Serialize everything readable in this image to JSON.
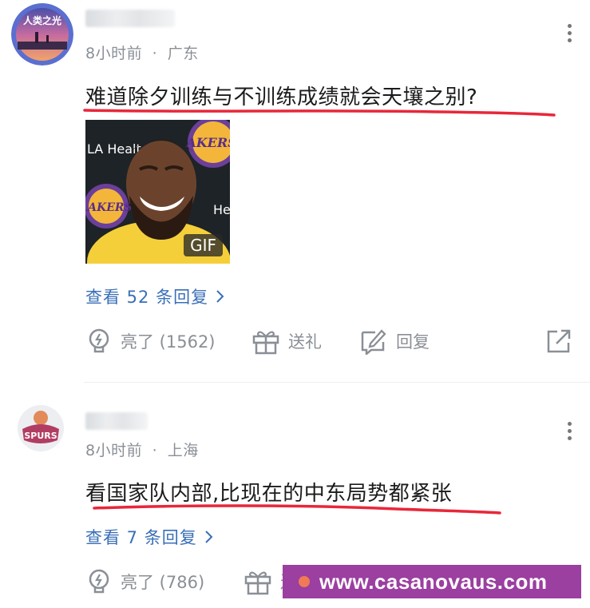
{
  "comments": [
    {
      "time": "8小时前",
      "location": "广东",
      "text": "难道除夕训练与不训练成绩就会天壤之别?",
      "attachment": {
        "badge": "GIF",
        "sign_texts": [
          "LA Healt",
          "LAKERS",
          "He",
          "AKERS"
        ]
      },
      "replies": "查看 52 条回复",
      "like_label": "亮了 (1562)",
      "gift_label": "送礼",
      "reply_label": "回复",
      "avatar_text": "人类之光"
    },
    {
      "time": "8小时前",
      "location": "上海",
      "text": "看国家队内部,比现在的中东局势都紧张",
      "replies": "查看 7 条回复",
      "like_label": "亮了 (786)",
      "gift_label": "送",
      "avatar_text": "SPURS"
    }
  ],
  "separator": "·",
  "watermark": "www.casanovaus.com",
  "icons": [
    "more-icon",
    "lightbulb-icon",
    "gift-icon",
    "edit-icon",
    "share-icon",
    "chevron-right-icon"
  ],
  "colors": {
    "underline": "#e8273a",
    "link": "#3a6fb7",
    "meta": "#8a8f96",
    "watermark_bg": "#9b3fa0"
  }
}
